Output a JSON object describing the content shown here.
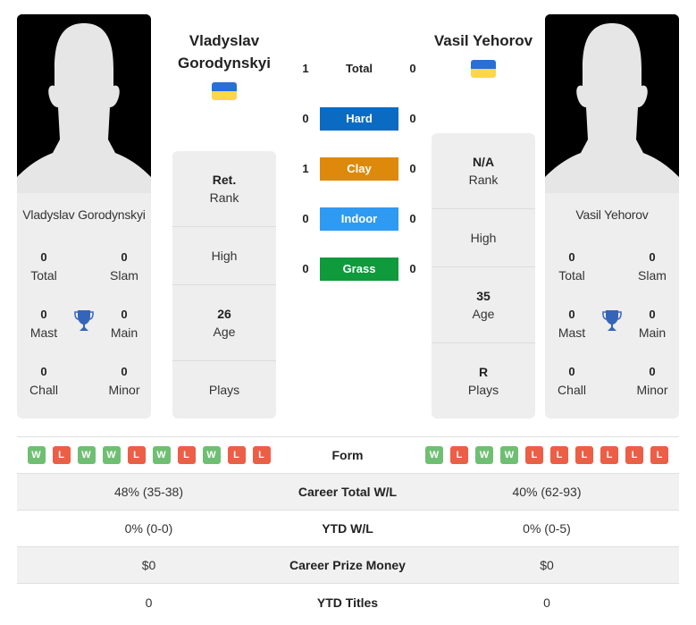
{
  "colors": {
    "hard": "#0b6bc2",
    "clay": "#dd8a0c",
    "indoor": "#2e9af2",
    "grass": "#0f9a3c",
    "win": "#6fbf73",
    "loss": "#ec5e45",
    "trophy": "#3565b8"
  },
  "players": [
    {
      "name": "Vladyslav Gorodynskyi",
      "name_line1": "Vladyslav",
      "name_line2": "Gorodynskyi",
      "flag": "ukraine-flag",
      "card_name": "Vladyslav Gorodynskyi",
      "titles": {
        "total": {
          "value": "0",
          "label": "Total"
        },
        "slam": {
          "value": "0",
          "label": "Slam"
        },
        "mast": {
          "value": "0",
          "label": "Mast"
        },
        "main": {
          "value": "0",
          "label": "Main"
        },
        "chall": {
          "value": "0",
          "label": "Chall"
        },
        "minor": {
          "value": "0",
          "label": "Minor"
        }
      },
      "info": {
        "rank_value": "Ret.",
        "rank_label": "Rank",
        "high_label": "High",
        "age_value": "26",
        "age_label": "Age",
        "plays_value": "",
        "plays_label": "Plays"
      },
      "form": [
        "W",
        "L",
        "W",
        "W",
        "L",
        "W",
        "L",
        "W",
        "L",
        "L"
      ],
      "career_wl": "48% (35-38)",
      "ytd_wl": "0% (0-0)",
      "prize_money": "$0",
      "ytd_titles": "0"
    },
    {
      "name": "Vasil Yehorov",
      "flag": "ukraine-flag",
      "card_name": "Vasil Yehorov",
      "titles": {
        "total": {
          "value": "0",
          "label": "Total"
        },
        "slam": {
          "value": "0",
          "label": "Slam"
        },
        "mast": {
          "value": "0",
          "label": "Mast"
        },
        "main": {
          "value": "0",
          "label": "Main"
        },
        "chall": {
          "value": "0",
          "label": "Chall"
        },
        "minor": {
          "value": "0",
          "label": "Minor"
        }
      },
      "info": {
        "rank_value": "N/A",
        "rank_label": "Rank",
        "high_label": "High",
        "age_value": "35",
        "age_label": "Age",
        "plays_value": "R",
        "plays_label": "Plays"
      },
      "form": [
        "W",
        "L",
        "W",
        "W",
        "L",
        "L",
        "L",
        "L",
        "L",
        "L"
      ],
      "career_wl": "40% (62-93)",
      "ytd_wl": "0% (0-5)",
      "prize_money": "$0",
      "ytd_titles": "0"
    }
  ],
  "h2h": [
    {
      "label": "Total",
      "left": "1",
      "right": "0",
      "type": "total"
    },
    {
      "label": "Hard",
      "left": "0",
      "right": "0",
      "type": "hard"
    },
    {
      "label": "Clay",
      "left": "1",
      "right": "0",
      "type": "clay"
    },
    {
      "label": "Indoor",
      "left": "0",
      "right": "0",
      "type": "indoor"
    },
    {
      "label": "Grass",
      "left": "0",
      "right": "0",
      "type": "grass"
    }
  ],
  "table": {
    "form_label": "Form",
    "career_wl_label": "Career Total W/L",
    "ytd_wl_label": "YTD W/L",
    "prize_label": "Career Prize Money",
    "ytd_titles_label": "YTD Titles"
  }
}
